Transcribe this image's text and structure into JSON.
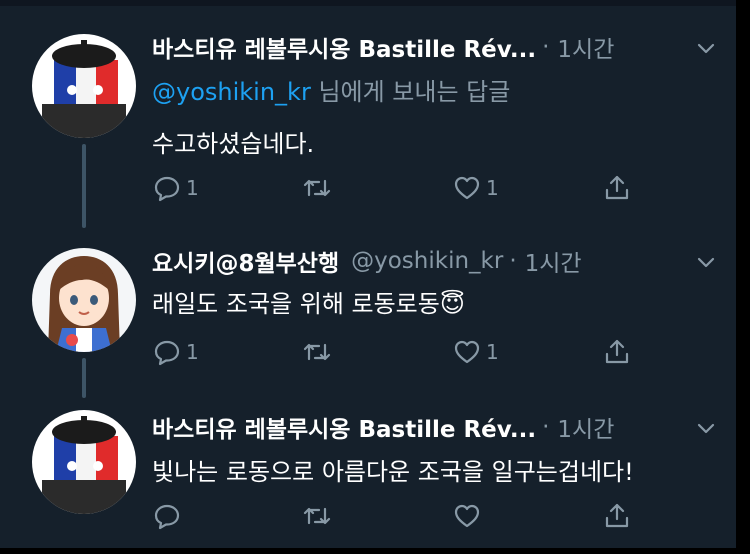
{
  "colors": {
    "background": "#15202b",
    "text_primary": "#ffffff",
    "text_secondary": "#8899a6",
    "accent": "#1da1f2",
    "thread_line": "#3d5466"
  },
  "tweets": [
    {
      "display_name": "바스티유 레볼루시옹 Bastille Rév...",
      "handle": "",
      "dot": "·",
      "time": "1시간",
      "replying_mention": "@yoshikin_kr",
      "replying_suffix": " 님에게 보내는 답글",
      "text": "수고하셨습네다.",
      "reply_count": "1",
      "retweet_count": "",
      "like_count": "1",
      "icons": [
        "reply-icon",
        "retweet-icon",
        "like-icon",
        "share-icon",
        "chevron-down-icon"
      ]
    },
    {
      "display_name": "요시키@8월부산행",
      "handle": "@yoshikin_kr",
      "dot": "·",
      "time": "1시간",
      "text": "래일도 조국을 위해 로동로동",
      "emoji": "😇",
      "reply_count": "1",
      "retweet_count": "",
      "like_count": "1"
    },
    {
      "display_name": "바스티유 레볼루시옹 Bastille Rév...",
      "handle": "",
      "dot": "·",
      "time": "1시간",
      "text": "빛나는 로동으로 아름다운 조국을 일구는겁네다!",
      "reply_count": "",
      "retweet_count": "",
      "like_count": ""
    }
  ]
}
